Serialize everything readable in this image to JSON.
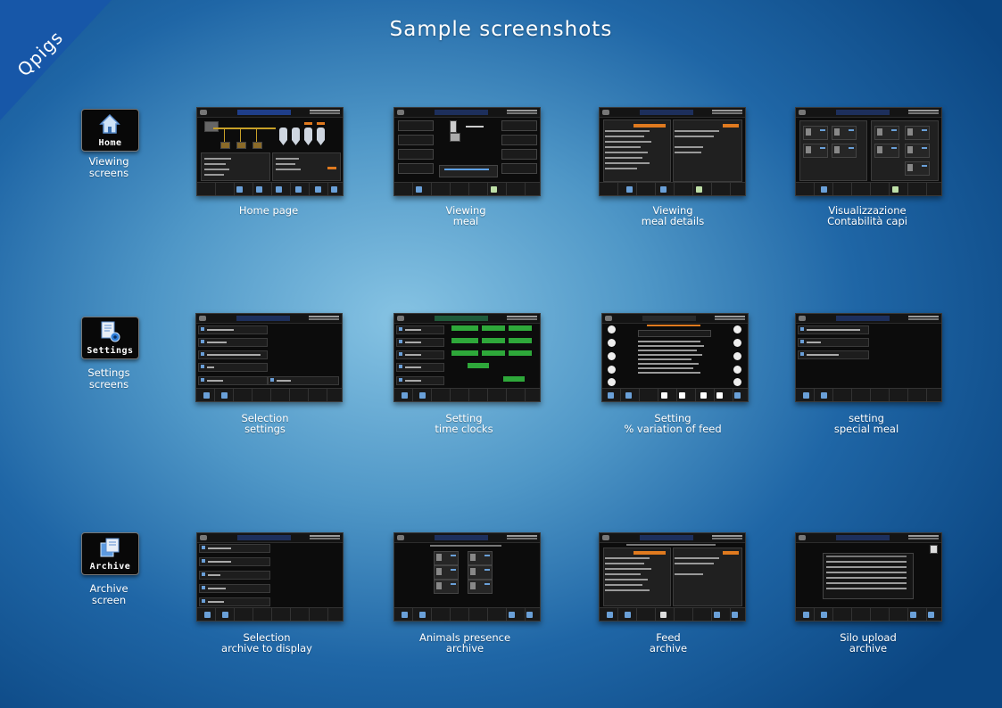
{
  "brand": {
    "corner_text": "Qpigs",
    "color": "#1757a8"
  },
  "page": {
    "title": "Sample screenshots"
  },
  "categories": [
    {
      "icon": "home-icon",
      "button_label": "Home",
      "caption": [
        "Viewing",
        "screens"
      ]
    },
    {
      "icon": "settings-document-icon",
      "button_label": "Settings",
      "caption": [
        "Settings",
        "screens"
      ]
    },
    {
      "icon": "archive-folder-icon",
      "button_label": "Archive",
      "caption": [
        "Archive",
        "screen"
      ]
    }
  ],
  "screenshots": [
    {
      "caption": [
        "Home page"
      ]
    },
    {
      "caption": [
        "Viewing",
        "meal"
      ]
    },
    {
      "caption": [
        "Viewing",
        "meal details"
      ]
    },
    {
      "caption": [
        "Visualizzazione",
        "Contabilità capi"
      ]
    },
    {
      "caption": [
        "Selection",
        "settings"
      ]
    },
    {
      "caption": [
        "Setting",
        "time clocks"
      ]
    },
    {
      "caption": [
        "Setting",
        "% variation of feed"
      ]
    },
    {
      "caption": [
        "setting",
        "special meal"
      ]
    },
    {
      "caption": [
        "Selection",
        "archive to display"
      ]
    },
    {
      "caption": [
        "Animals presence",
        "archive"
      ]
    },
    {
      "caption": [
        "Feed",
        "archive"
      ]
    },
    {
      "caption": [
        "Silo upload",
        "archive"
      ]
    }
  ]
}
